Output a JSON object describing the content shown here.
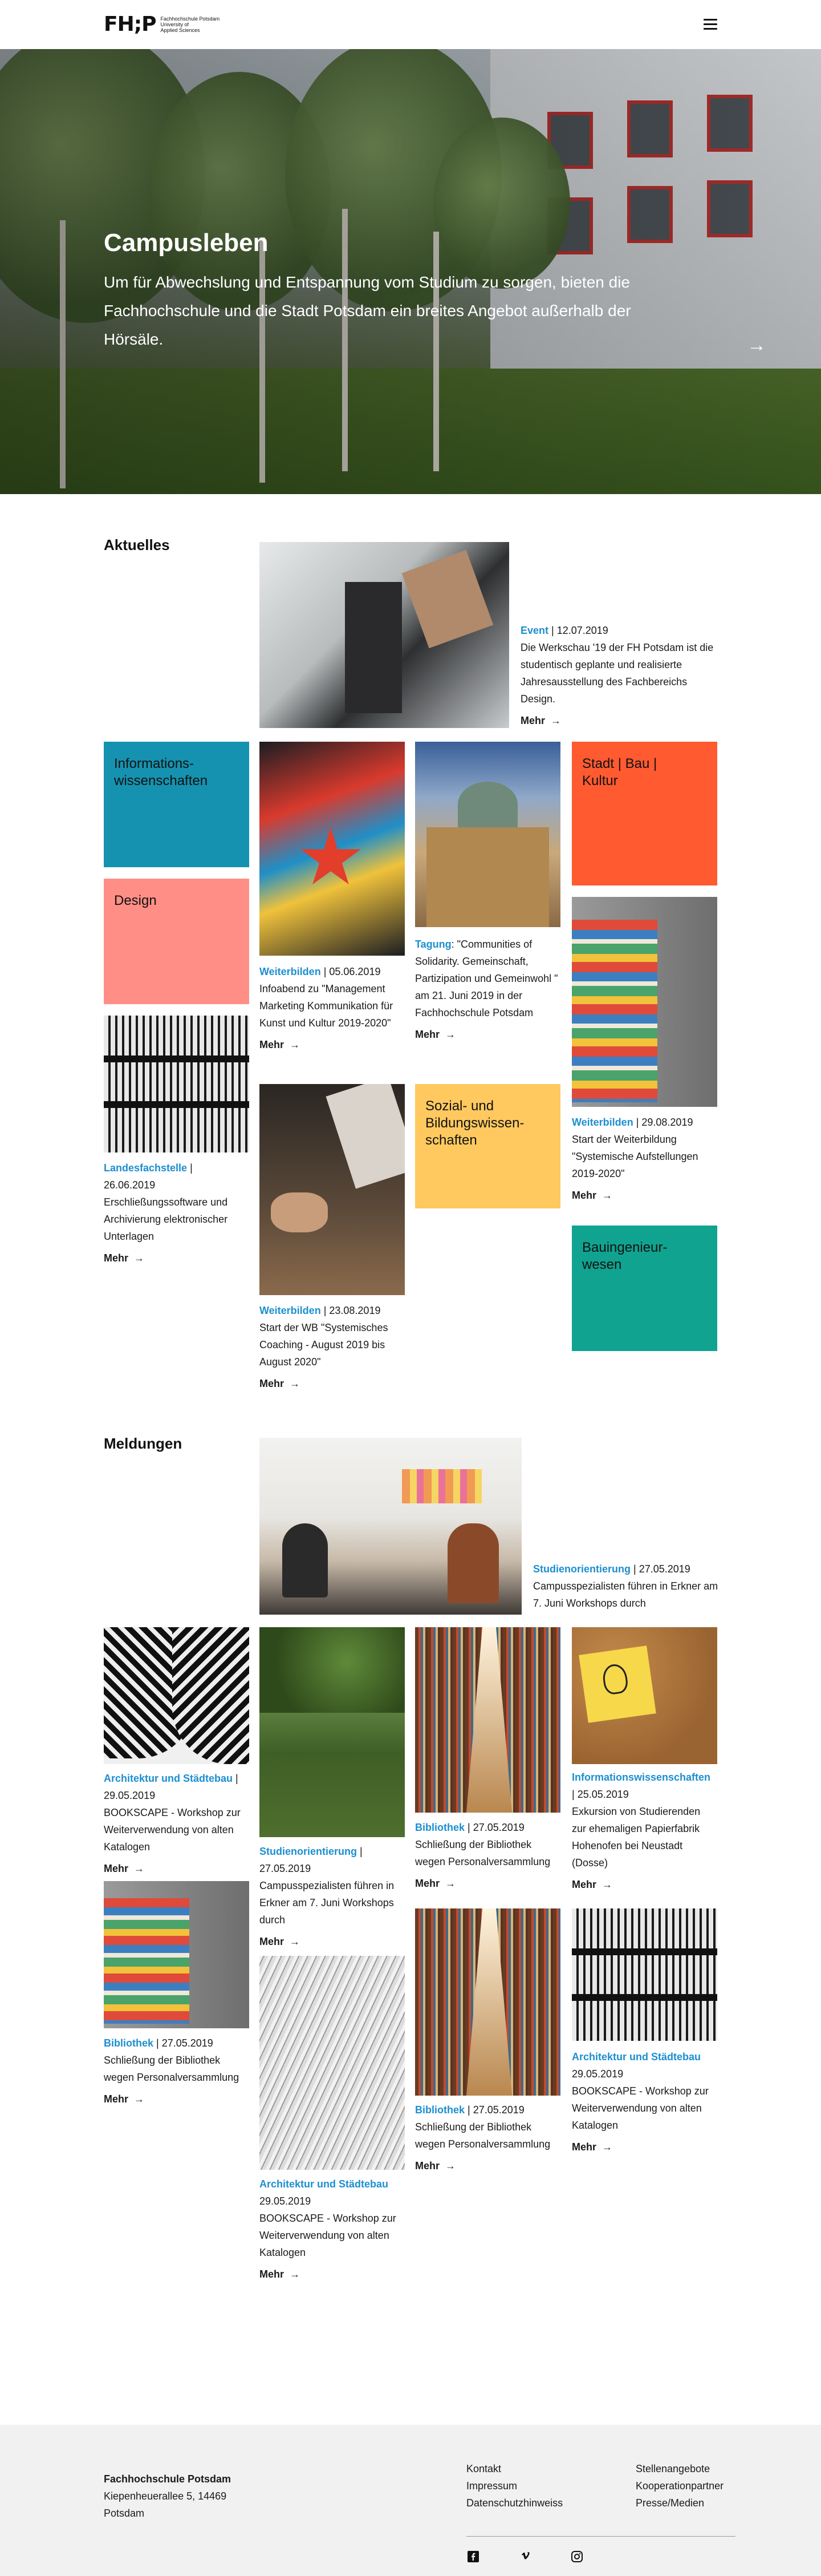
{
  "header": {
    "logo_mark": "FH;P",
    "logo_lines": [
      "Fachhochschule Potsdam",
      "University of",
      "Applied Sciences"
    ]
  },
  "hero": {
    "title": "Campusleben",
    "text": "Um für Abwechslung und Entspannung vom Studium zu sorgen, bieten die Fachhochschule und die Stadt Potsdam ein breites Angebot außerhalb der Hörsäle."
  },
  "aktuelles": {
    "title": "Aktuelles",
    "featured": {
      "category": "Event",
      "date": "12.07.2019",
      "text": "Die Werkschau '19 der FH Potsdam ist die studentisch geplante und realisierte Jahresausstellung des Fachbereichs Design.",
      "more": "Mehr"
    },
    "tiles": {
      "informationswissenschaften": [
        "Informations-",
        "wissenschaften"
      ],
      "stadt_bau_kultur": [
        "Stadt | Bau |",
        "Kultur"
      ],
      "design": [
        "Design"
      ],
      "sozial": [
        "Sozial- und",
        "Bildungswissen-",
        "schaften"
      ],
      "bauingenieurwesen": [
        "Bauingenieur-",
        "wesen"
      ]
    },
    "cards": {
      "weiterbilden_kunst": {
        "category": "Weiterbilden",
        "date": "05.06.2019",
        "text": "Infoabend zu \"Management Marketing Kommunikation für Kunst und Kultur 2019-2020\"",
        "more": "Mehr"
      },
      "tagung": {
        "category": "Tagung",
        "text": ": \"Communities of Solidarity. Gemeinschaft, Partizipation und Gemeinwohl \" am 21. Juni 2019 in der Fachhochschule Potsdam",
        "more": "Mehr"
      },
      "landesfachstelle": {
        "category": "Landesfachstelle",
        "date": "26.06.2019",
        "text": "Erschließungssoftware und Archivierung elektronischer Unterlagen",
        "more": "Mehr"
      },
      "weiterbilden_coaching": {
        "category": "Weiterbilden",
        "date": "23.08.2019",
        "text": "Start der WB \"Systemisches Coaching - August 2019 bis August 2020\"",
        "more": "Mehr"
      },
      "weiterbilden_aufstellungen": {
        "category": "Weiterbilden",
        "date": "29.08.2019",
        "text": "Start der Weiterbildung \"Systemische Aufstellungen 2019-2020\"",
        "more": "Mehr"
      }
    }
  },
  "meldungen": {
    "title": "Meldungen",
    "featured": {
      "category": "Studienorientierung",
      "date": "27.05.2019",
      "text": "Campusspezialisten führen in Erkner am 7. Juni Workshops durch"
    },
    "cards": {
      "arch1": {
        "category": "Architektur und Städtebau",
        "date": "29.05.2019",
        "text": "BOOKSCAPE - Workshop zur Weiterverwendung von alten Katalogen",
        "more": "Mehr"
      },
      "studien": {
        "category": "Studienorientierung",
        "date": "27.05.2019",
        "text": "Campusspezialisten führen in Erkner am 7. Juni Workshops durch",
        "more": "Mehr"
      },
      "biblio1": {
        "category": "Bibliothek",
        "date": "27.05.2019",
        "text": "Schließung der Bibliothek wegen Personalversammlung",
        "more": "Mehr"
      },
      "infowiss": {
        "category": "Informationswissenschaften",
        "date": "25.05.2019",
        "text": "Exkursion von Studierenden zur ehemaligen Papierfabrik Hohenofen bei Neustadt (Dosse)",
        "more": "Mehr"
      },
      "biblio2": {
        "category": "Bibliothek",
        "date": "27.05.2019",
        "text": "Schließung der Bibliothek wegen Personalversammlung",
        "more": "Mehr"
      },
      "arch2": {
        "category": "Architektur und Städtebau",
        "date": "29.05.2019",
        "text": "BOOKSCAPE - Workshop zur Weiterverwendung von alten Katalogen",
        "more": "Mehr"
      },
      "biblio3": {
        "category": "Bibliothek",
        "date": "27.05.2019",
        "text": "Schließung der Bibliothek wegen Personalversammlung",
        "more": "Mehr"
      },
      "arch3": {
        "category": "Architektur und Städtebau",
        "date": "29.05.2019",
        "text": "BOOKSCAPE - Workshop zur Weiterverwendung von alten Katalogen",
        "more": "Mehr"
      }
    }
  },
  "footer": {
    "name": "Fachhochschule Potsdam",
    "street": "Kiepenheuerallee 5, 14469",
    "city": "Potsdam",
    "links_left": [
      "Kontakt",
      "Impressum",
      "Datenschutzhinweiss"
    ],
    "links_right": [
      "Stellenangebote",
      "Kooperationpartner",
      "Presse/Medien"
    ],
    "social": [
      "facebook-icon",
      "vimeo-icon",
      "instagram-icon"
    ]
  },
  "colors": {
    "accent_blue": "#1c8fd0",
    "tile_teal": "#1592b0",
    "tile_orange": "#ff5a30",
    "tile_pink": "#ff8f86",
    "tile_yellow": "#ffc95f",
    "tile_green": "#0fa390"
  }
}
